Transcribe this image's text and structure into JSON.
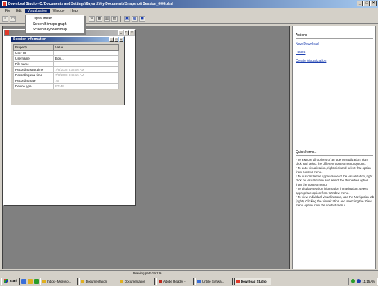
{
  "window": {
    "title": "Download Studio - C:\\Documents and Settings\\Bayardt\\My Documents\\Snapshot\\ Session_0006.dsd"
  },
  "menubar": {
    "items": [
      "File",
      "Edit",
      "Visualization",
      "Window",
      "Help"
    ]
  },
  "dropdown": {
    "items": [
      "Digital meter",
      "Screen Bitmaps graph",
      "Screen Keyboard map"
    ]
  },
  "child_window": {
    "title": ""
  },
  "inner_window": {
    "title": "Session Information",
    "columns": [
      "Property",
      "Value"
    ],
    "rows": [
      {
        "property": "User ID",
        "value": ""
      },
      {
        "property": "Username",
        "value": "Bob..."
      },
      {
        "property": "File name",
        "value": ""
      },
      {
        "property": "Recording start time",
        "value": "7/8/2008 8:38:06 AM"
      },
      {
        "property": "Recording end time",
        "value": "7/8/2008 8:46:15 AM"
      },
      {
        "property": "Recording rate",
        "value": "75"
      },
      {
        "property": "Device type",
        "value": "FTMS"
      }
    ]
  },
  "actions": {
    "heading": "Actions",
    "links": [
      "New Download",
      "Delete",
      "Create Visualization"
    ]
  },
  "quick_items": {
    "heading": "Quick Items...",
    "lines": [
      "* To explore all options of an open visualization, right click and select the different context menu options.",
      "* To auto visualization, right click and select that option from context menu.",
      "* To customize the appearance of the visualization, right click on visualization and select the Properties option from the context menu.",
      "* To display session information in navigation, select appropriate option from Window menu.",
      "* To view individual visualizations, use the Navigation tab (right). Clicking the visualization and selecting the View menu option from the context menu."
    ]
  },
  "statusbar": {
    "text": "Drawing path 19/136"
  },
  "taskbar": {
    "start": "start",
    "tasks": [
      {
        "label": "Inbox - Microso...",
        "active": false
      },
      {
        "label": "Documentation",
        "active": false
      },
      {
        "label": "Documentation",
        "active": false
      },
      {
        "label": "Adobe Reader -",
        "active": false
      },
      {
        "label": "Untitle Softwa...",
        "active": false
      },
      {
        "label": "Download Studio",
        "active": true
      }
    ],
    "clock": "11:15 AM"
  }
}
